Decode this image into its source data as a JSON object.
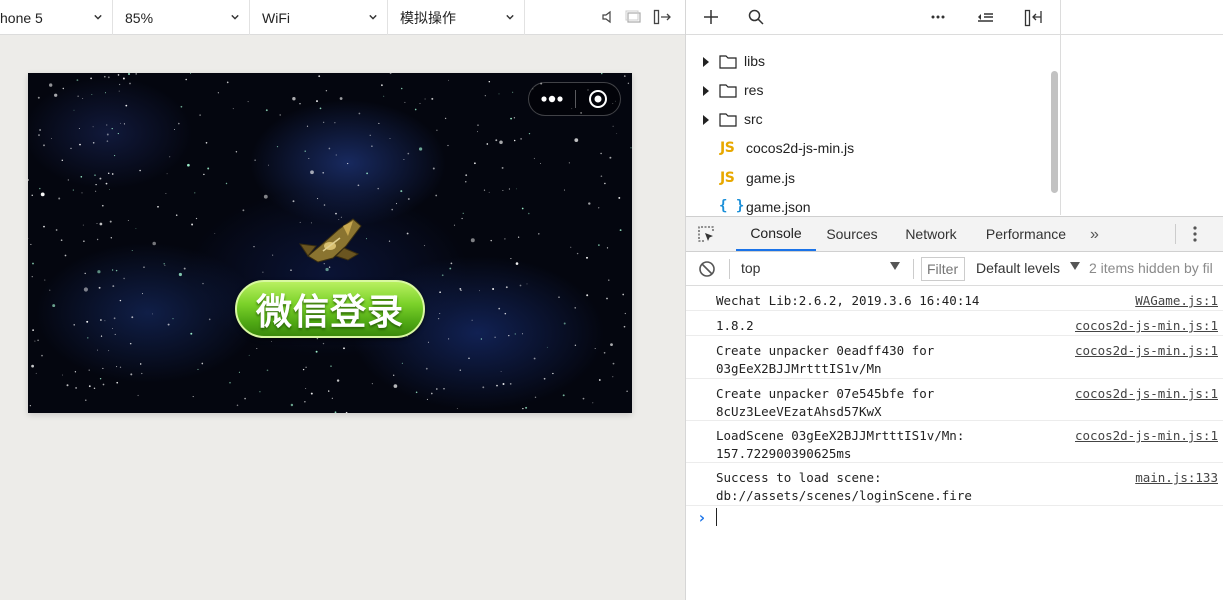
{
  "simulator": {
    "device": "hone 5",
    "zoom": "85%",
    "network": "WiFi",
    "action": "模拟操作",
    "icons": [
      "volume-icon",
      "window-icon",
      "detach-icon"
    ]
  },
  "game": {
    "login_button": "微信登录",
    "capsule_icons": [
      "more-dots-icon",
      "target-icon"
    ]
  },
  "file_tree": {
    "toolbar_icons": [
      "plus-icon",
      "search-icon",
      "more-icon",
      "collapse-icon",
      "layout-icon"
    ],
    "items": [
      {
        "type": "folder",
        "label": "libs"
      },
      {
        "type": "folder",
        "label": "res"
      },
      {
        "type": "folder",
        "label": "src"
      },
      {
        "type": "js",
        "badge": "JS",
        "label": "cocos2d-js-min.js"
      },
      {
        "type": "js",
        "badge": "JS",
        "label": "game.js"
      },
      {
        "type": "json",
        "badge": "{ }",
        "label": "game.json"
      }
    ]
  },
  "devtools": {
    "tabs": [
      "Console",
      "Sources",
      "Network",
      "Performance"
    ],
    "active_tab": "Console",
    "more_tabs": "»",
    "context": "top",
    "filter_placeholder": "Filter",
    "levels": "Default levels",
    "hidden_count": "2 items hidden by fil",
    "logs": [
      {
        "message": "Wechat Lib:2.6.2, 2019.3.6 16:40:14",
        "source": "WAGame.js:1"
      },
      {
        "message": "1.8.2",
        "source": "cocos2d-js-min.js:1"
      },
      {
        "message": "Create unpacker 0eadff430 for\n03gEeX2BJJMrtttIS1v/Mn",
        "source": "cocos2d-js-min.js:1"
      },
      {
        "message": "Create unpacker 07e545bfe for\n8cUz3LeeVEzatAhsd57KwX",
        "source": "cocos2d-js-min.js:1"
      },
      {
        "message": "LoadScene 03gEeX2BJJMrtttIS1v/Mn:\n157.722900390625ms",
        "source": "cocos2d-js-min.js:1"
      },
      {
        "message": "Success to load scene:\ndb://assets/scenes/loginScene.fire",
        "source": "main.js:133"
      }
    ],
    "prompt": "›"
  },
  "colors": {
    "accent": "#1a73e8",
    "js_badge": "#e8a800",
    "json_badge": "#1a8fd8",
    "login_green": "#5cb81a"
  }
}
